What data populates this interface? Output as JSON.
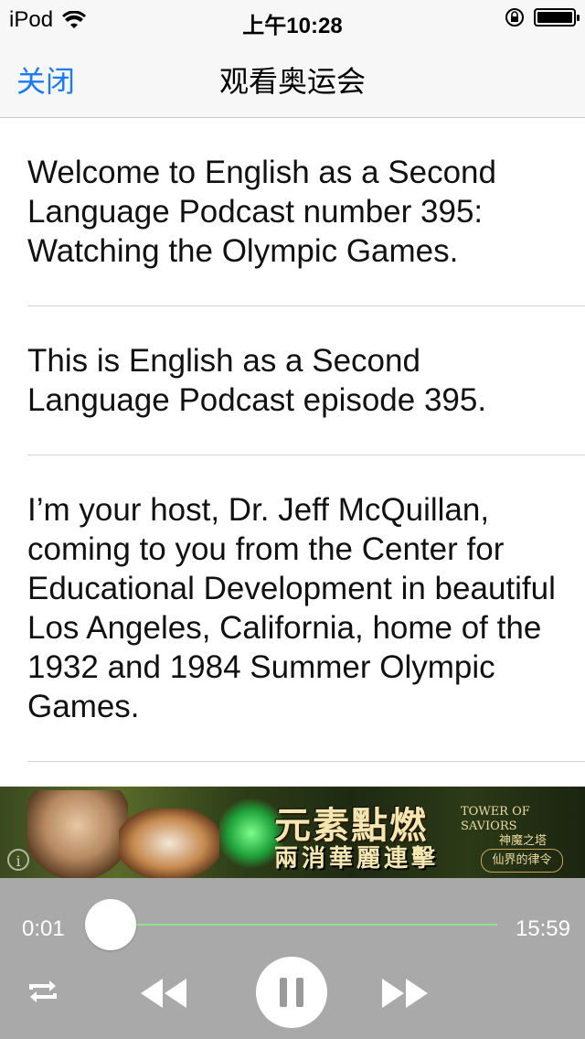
{
  "status_bar": {
    "carrier": "iPod",
    "time": "上午10:28"
  },
  "nav": {
    "close_label": "关闭",
    "title": "观看奥运会"
  },
  "content": {
    "paragraphs": [
      "Welcome to English as a Second Language Podcast number 395: Watching the Olympic Games.",
      "This is English as a Second Language Podcast episode 395.",
      "I’m your host, Dr. Jeff McQuillan, coming to you from the Center for Educational Development in beautiful Los Angeles, California, home of the 1932 and 1984 Summer Olympic Games."
    ]
  },
  "ad": {
    "headline": "元素點燃",
    "subline": "兩消華麗連擊",
    "brand_en": "TOWER OF SAVIORS",
    "brand_cn": "神魔之塔",
    "badge": "仙界的律令",
    "info_icon": "info-icon"
  },
  "player": {
    "elapsed": "0:01",
    "total": "15:59",
    "progress": 0.001,
    "controls": [
      "repeat-icon",
      "rewind-icon",
      "pause-icon",
      "fast-forward-icon"
    ]
  }
}
